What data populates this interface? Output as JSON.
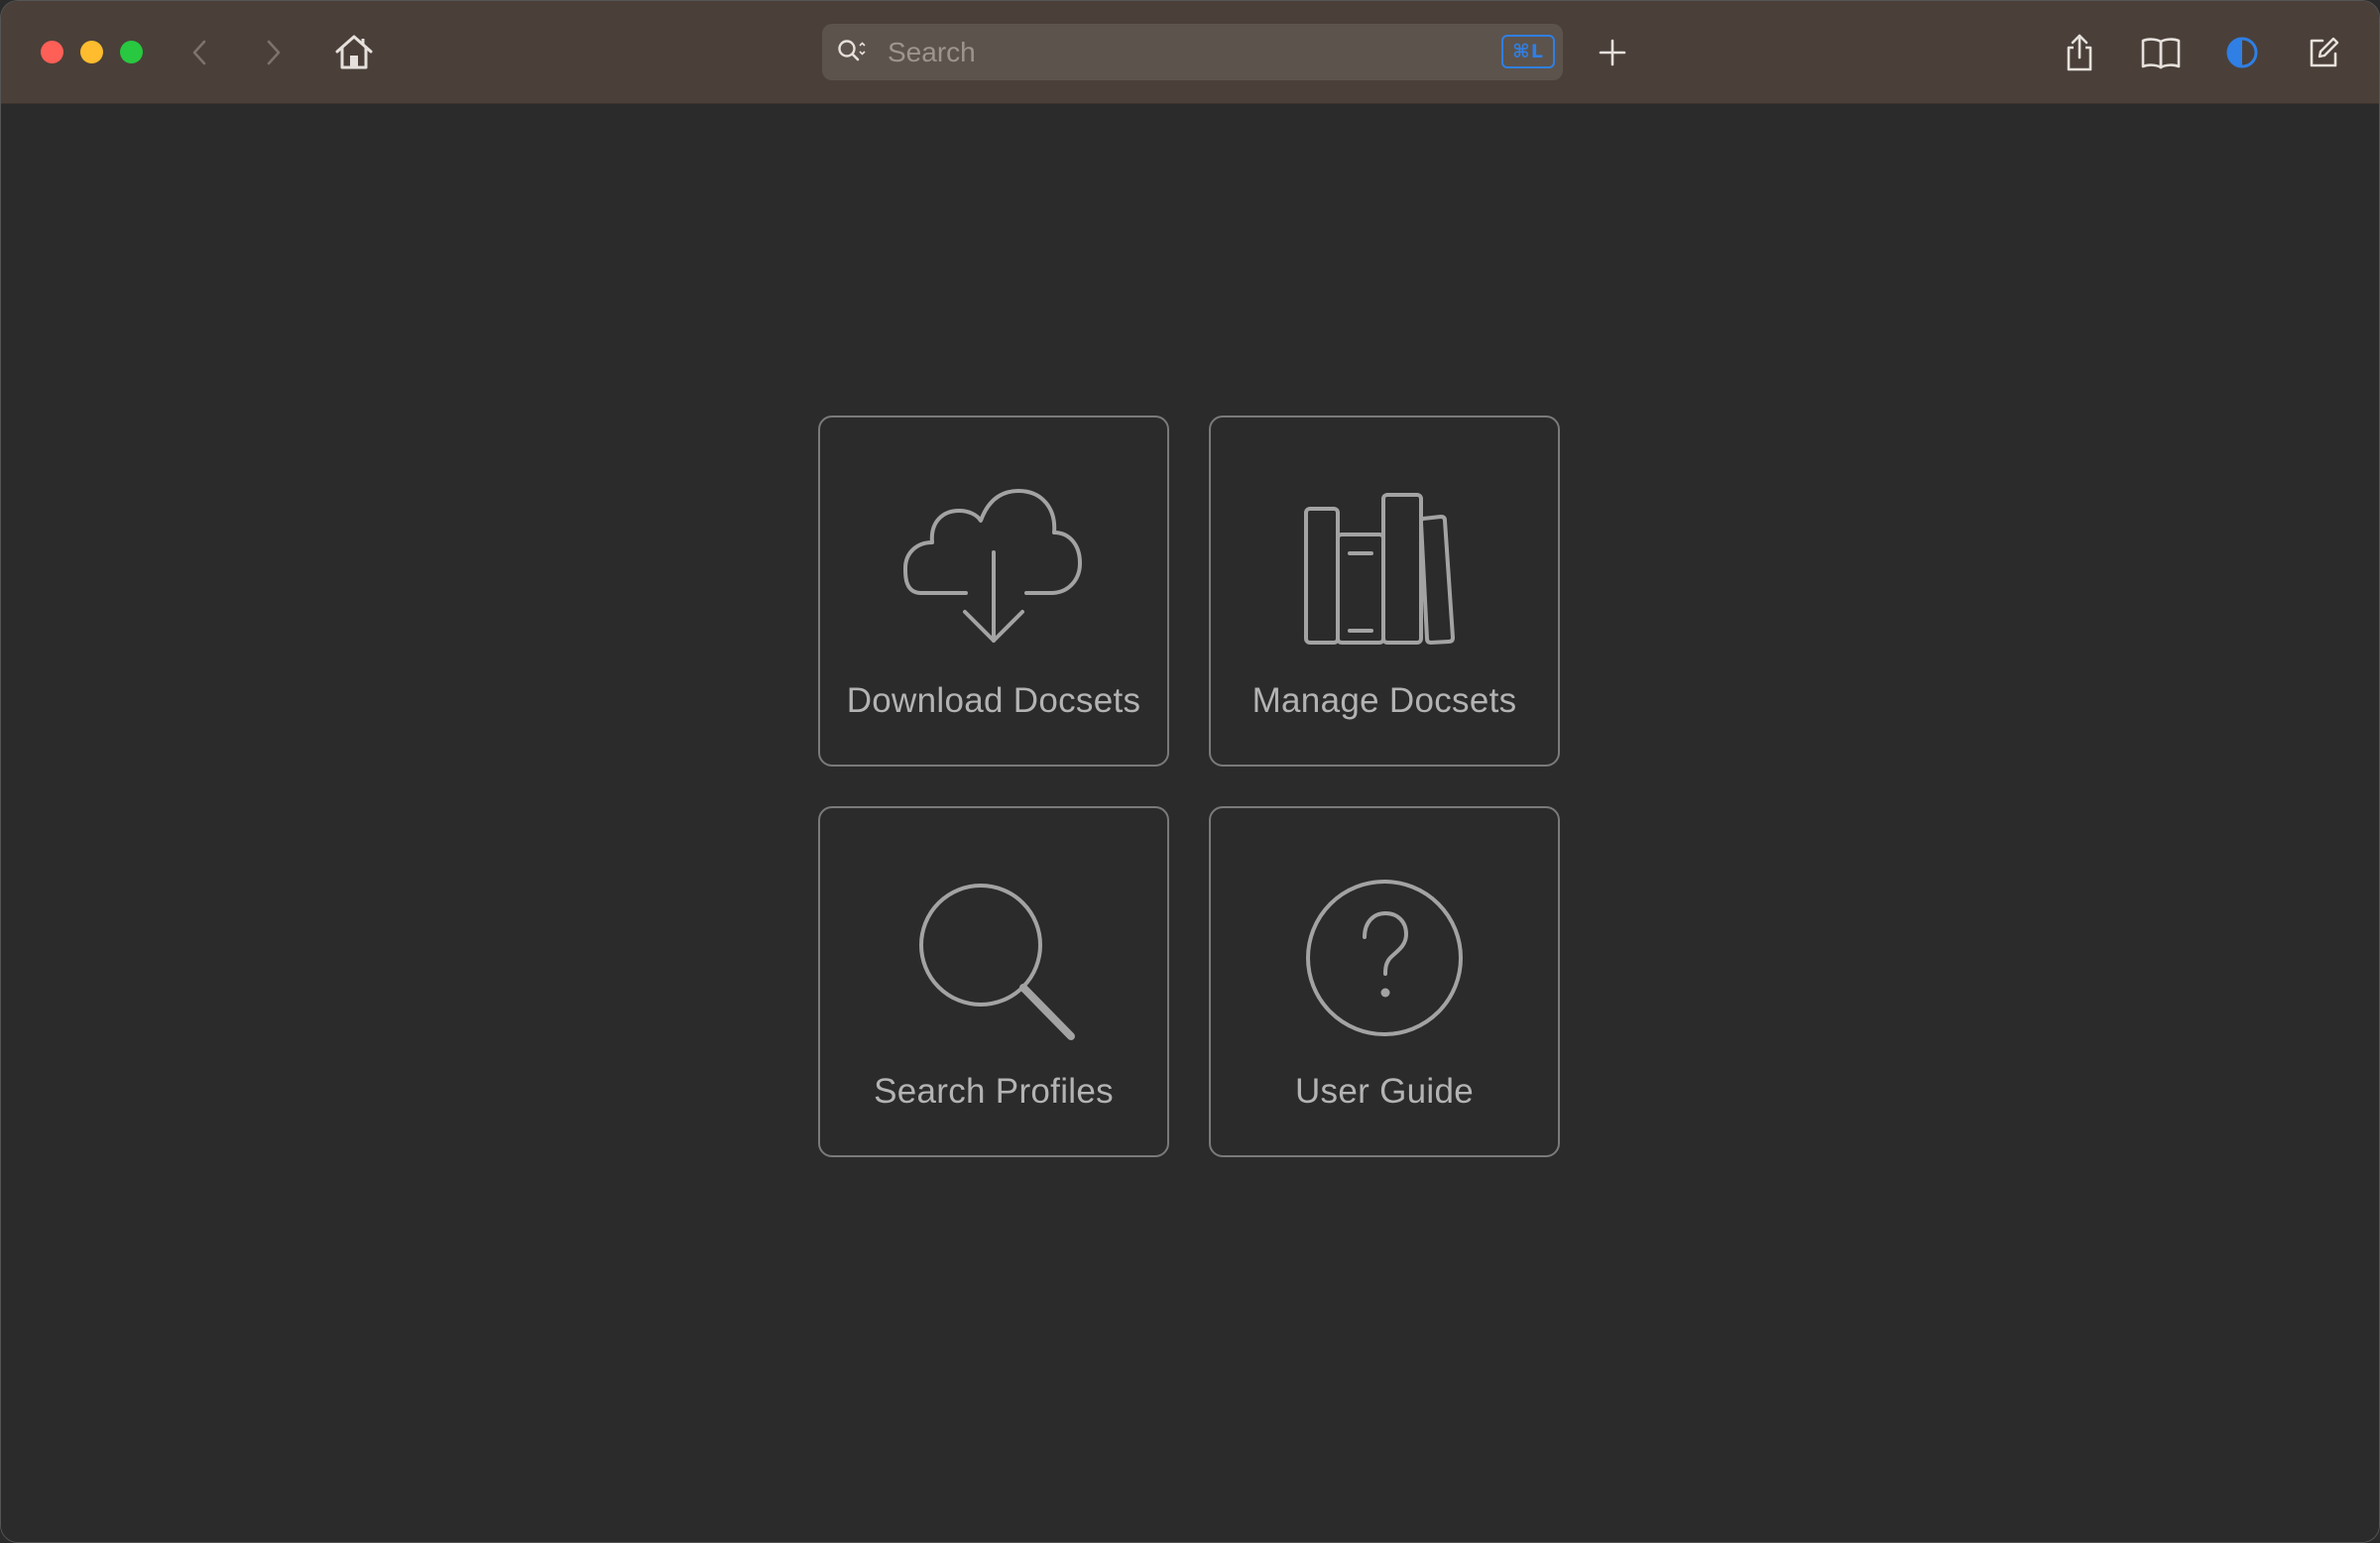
{
  "toolbar": {
    "search": {
      "placeholder": "Search",
      "value": "",
      "shortcut": "⌘L"
    }
  },
  "colors": {
    "toolbar_bg": "#4a4039",
    "content_bg": "#2b2b2b",
    "accent": "#2f7fe5",
    "traffic_close": "#fe5f57",
    "traffic_minimize": "#febc2e",
    "traffic_maximize": "#28c840"
  },
  "icons": {
    "toolbar": [
      "chevron-left-icon",
      "chevron-right-icon",
      "home-icon",
      "search-icon",
      "plus-icon",
      "share-icon",
      "book-icon",
      "contrast-icon",
      "compose-icon"
    ],
    "tiles": [
      "cloud-download-icon",
      "books-icon",
      "magnifier-icon",
      "question-circle-icon"
    ]
  },
  "tiles": [
    {
      "label": "Download Docsets",
      "icon": "cloud-download-icon"
    },
    {
      "label": "Manage Docsets",
      "icon": "books-icon"
    },
    {
      "label": "Search Profiles",
      "icon": "magnifier-icon"
    },
    {
      "label": "User Guide",
      "icon": "question-circle-icon"
    }
  ]
}
